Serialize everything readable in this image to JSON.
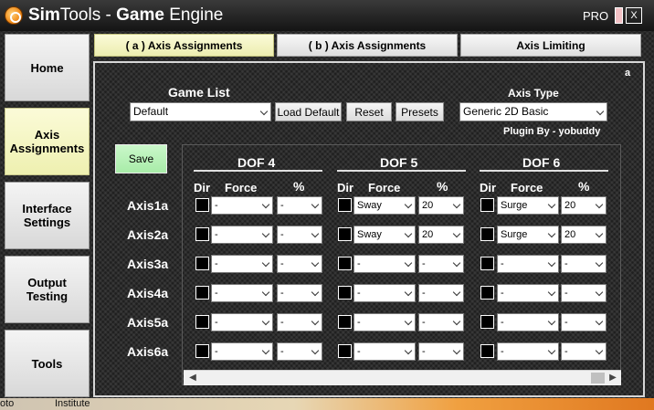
{
  "window": {
    "title_brand_part1": "Sim",
    "title_brand_part2": "Tools",
    "title_sep": "-",
    "title_part1": "Game",
    "title_part2": "Engine",
    "edition": "PRO",
    "close_label": "X"
  },
  "nav": {
    "items": [
      {
        "label": "Home"
      },
      {
        "label": "Axis Assignments",
        "active": true
      },
      {
        "label": "Interface Settings"
      },
      {
        "label": "Output Testing"
      },
      {
        "label": "Tools"
      }
    ]
  },
  "tabs": [
    {
      "label": "( a ) Axis Assignments",
      "active": true
    },
    {
      "label": "( b ) Axis Assignments"
    },
    {
      "label": "Axis Limiting"
    }
  ],
  "panel": {
    "corner_label": "a",
    "game_list_label": "Game List",
    "game_list_value": "Default",
    "load_default_label": "Load Default",
    "reset_label": "Reset",
    "presets_label": "Presets",
    "axis_type_label": "Axis Type",
    "axis_type_value": "Generic 2D Basic",
    "plugin_by": "Plugin By - yobuddy",
    "save_label": "Save",
    "col_dir": "Dir",
    "col_force": "Force",
    "col_percent": "%"
  },
  "dofs": [
    "DOF 4",
    "DOF 5",
    "DOF 6"
  ],
  "axes": [
    {
      "label": "Axis1a",
      "dof4": {
        "force": "-",
        "pct": "-"
      },
      "dof5": {
        "force": "Sway",
        "pct": "20"
      },
      "dof6": {
        "force": "Surge",
        "pct": "20"
      }
    },
    {
      "label": "Axis2a",
      "dof4": {
        "force": "-",
        "pct": "-"
      },
      "dof5": {
        "force": "Sway",
        "pct": "20"
      },
      "dof6": {
        "force": "Surge",
        "pct": "20"
      }
    },
    {
      "label": "Axis3a",
      "dof4": {
        "force": "-",
        "pct": "-"
      },
      "dof5": {
        "force": "-",
        "pct": "-"
      },
      "dof6": {
        "force": "-",
        "pct": "-"
      }
    },
    {
      "label": "Axis4a",
      "dof4": {
        "force": "-",
        "pct": "-"
      },
      "dof5": {
        "force": "-",
        "pct": "-"
      },
      "dof6": {
        "force": "-",
        "pct": "-"
      }
    },
    {
      "label": "Axis5a",
      "dof4": {
        "force": "-",
        "pct": "-"
      },
      "dof5": {
        "force": "-",
        "pct": "-"
      },
      "dof6": {
        "force": "-",
        "pct": "-"
      }
    },
    {
      "label": "Axis6a",
      "dof4": {
        "force": "-",
        "pct": "-"
      },
      "dof5": {
        "force": "-",
        "pct": "-"
      },
      "dof6": {
        "force": "-",
        "pct": "-"
      }
    }
  ],
  "desktop": {
    "label_left": "oto",
    "label_right": "Institute"
  }
}
